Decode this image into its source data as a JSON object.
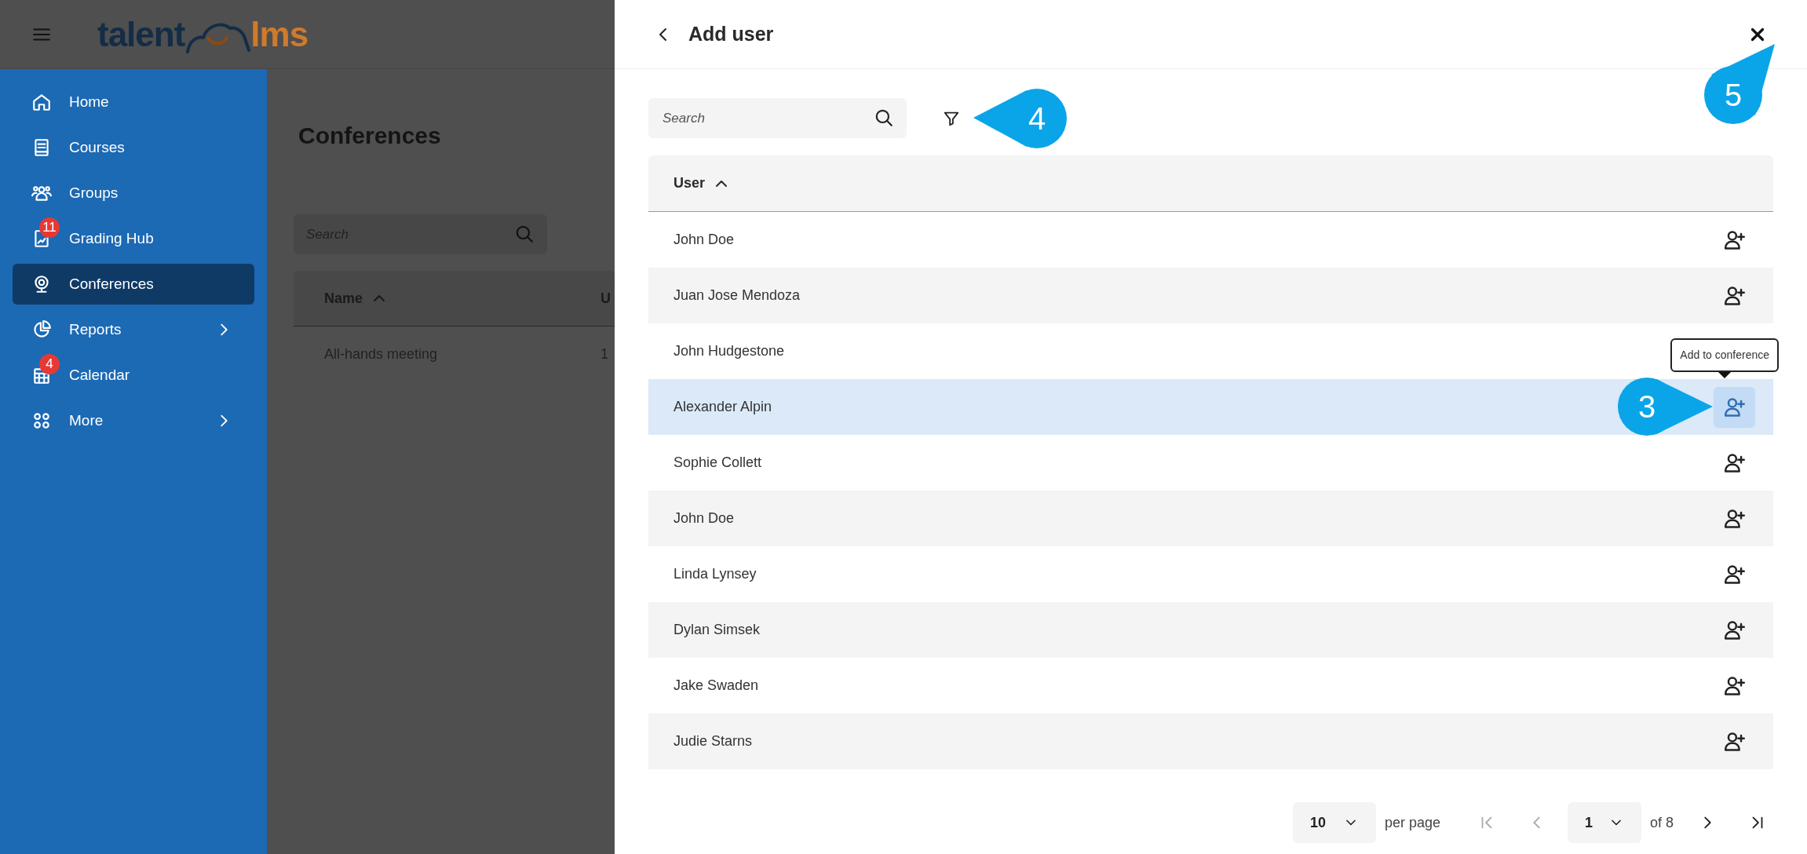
{
  "header": {
    "logo": {
      "part_1": "talent",
      "part_2": "lms"
    }
  },
  "sidebar": {
    "items": [
      {
        "label": "Home",
        "selected": false,
        "has_submenu": false
      },
      {
        "label": "Courses",
        "selected": false,
        "has_submenu": false
      },
      {
        "label": "Groups",
        "selected": false,
        "has_submenu": false
      },
      {
        "label": "Grading Hub",
        "selected": false,
        "has_submenu": false,
        "badge": "11"
      },
      {
        "label": "Conferences",
        "selected": true,
        "has_submenu": false
      },
      {
        "label": "Reports",
        "selected": false,
        "has_submenu": true
      },
      {
        "label": "Calendar",
        "selected": false,
        "has_submenu": false,
        "badge": "4"
      },
      {
        "label": "More",
        "selected": false,
        "has_submenu": true
      }
    ]
  },
  "page": {
    "title": "Conferences",
    "search": {
      "placeholder": "Search"
    },
    "table": {
      "columns": [
        {
          "label": "Name",
          "sort_ascending": true
        },
        {
          "label": "U",
          "sort_ascending": false
        }
      ],
      "rows": [
        [
          "All-hands meeting",
          "1"
        ]
      ]
    }
  },
  "drawer": {
    "title": "Add user",
    "search": {
      "placeholder": "Search"
    },
    "table": {
      "columns": [
        {
          "label": "User",
          "sort_ascending": true
        }
      ],
      "rows": [
        {
          "name": "John Doe",
          "selected": false
        },
        {
          "name": "Juan Jose Mendoza",
          "selected": false
        },
        {
          "name": "John Hudgestone",
          "selected": false
        },
        {
          "name": "Alexander Alpin",
          "selected": true,
          "tooltip": "Add to conference"
        },
        {
          "name": "Sophie Collett",
          "selected": false
        },
        {
          "name": "John Doe",
          "selected": false
        },
        {
          "name": "Linda Lynsey",
          "selected": false
        },
        {
          "name": "Dylan Simsek",
          "selected": false
        },
        {
          "name": "Jake Swaden",
          "selected": false
        },
        {
          "name": "Judie Starns",
          "selected": false
        }
      ]
    },
    "pagination": {
      "per_page": "10",
      "per_page_label": "per page",
      "page": "1",
      "page_total": "of 8"
    }
  },
  "callouts": [
    {
      "number": "3",
      "kind": "point_right"
    },
    {
      "number": "4",
      "kind": "point_left"
    },
    {
      "number": "5",
      "kind": "point_up_right"
    }
  ]
}
